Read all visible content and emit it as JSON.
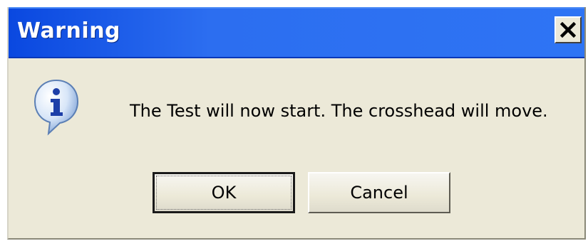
{
  "window": {
    "title": "Warning",
    "close_icon": "close-icon"
  },
  "message": {
    "icon": "information-icon",
    "text": "The Test will now start. The crosshead will move."
  },
  "buttons": {
    "ok_label": "OK",
    "cancel_label": "Cancel"
  },
  "colors": {
    "titlebar": "#2e74f4",
    "dialog_bg": "#ece9d8"
  }
}
